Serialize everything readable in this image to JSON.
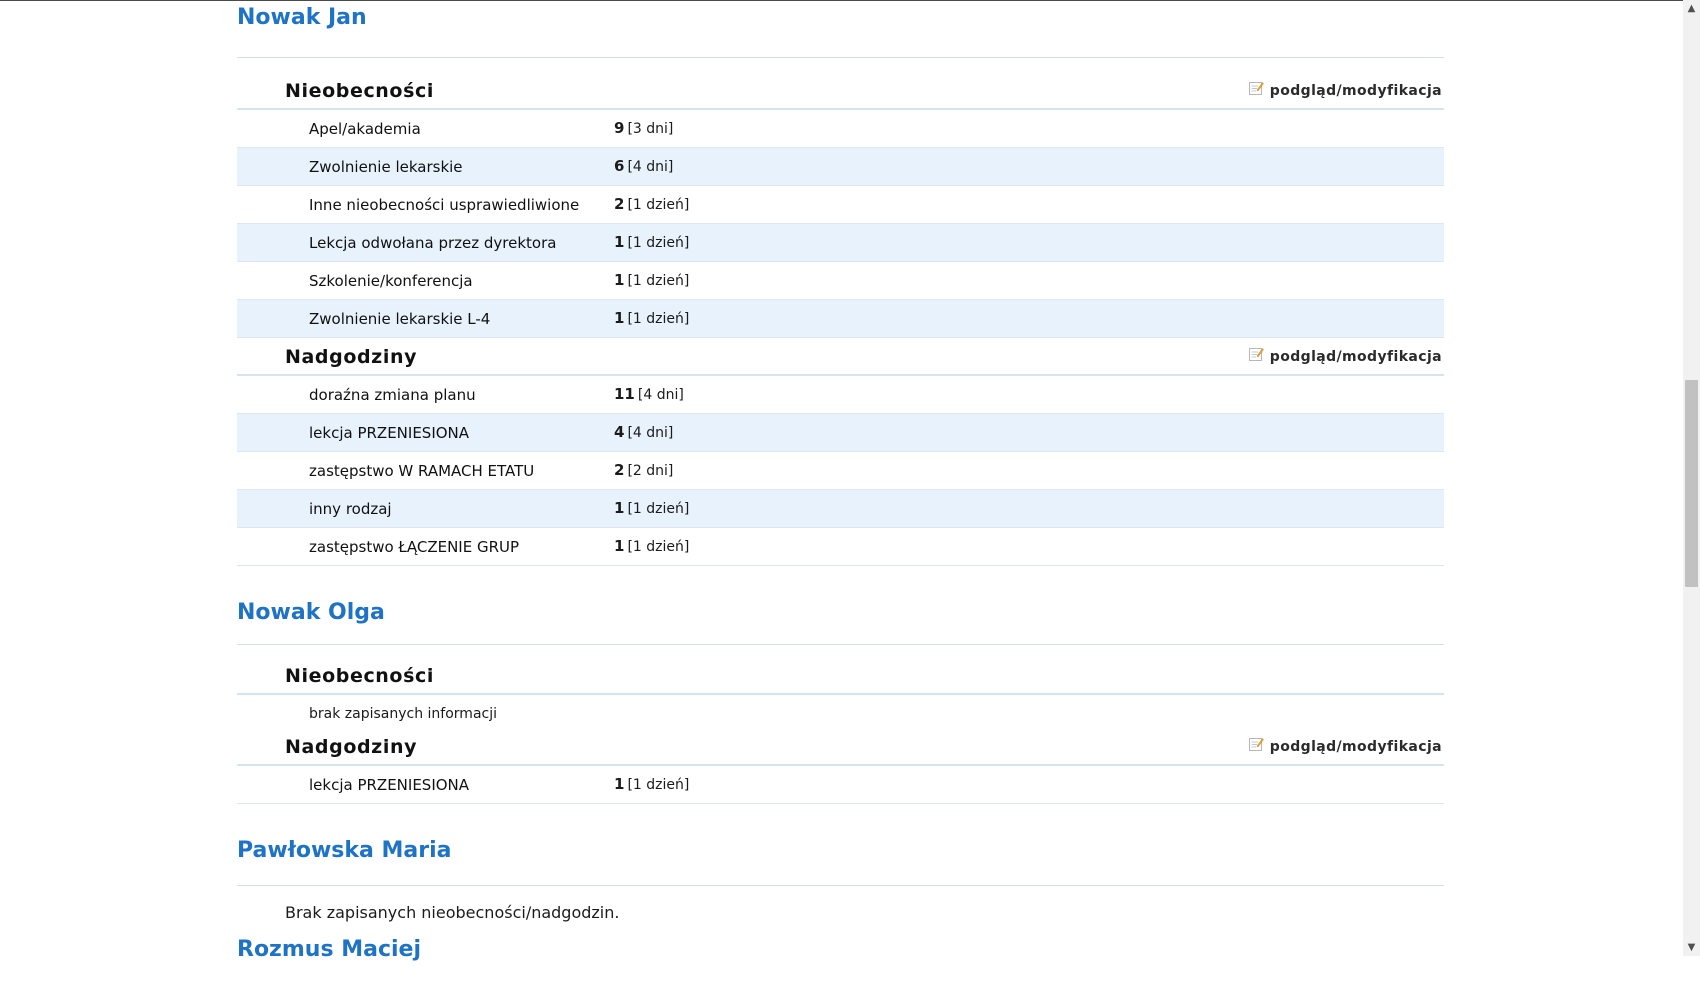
{
  "people": [
    {
      "name": "Nowak Jan",
      "absences": {
        "title": "Nieobecności",
        "link": "podgląd/modyfikacja",
        "rows": [
          {
            "label": "Apel/akademia",
            "count": "9",
            "days": "[3 dni]"
          },
          {
            "label": "Zwolnienie lekarskie",
            "count": "6",
            "days": "[4 dni]"
          },
          {
            "label": "Inne nieobecności usprawiedliwione",
            "count": "2",
            "days": "[1 dzień]"
          },
          {
            "label": "Lekcja odwołana przez dyrektora",
            "count": "1",
            "days": "[1 dzień]"
          },
          {
            "label": "Szkolenie/konferencja",
            "count": "1",
            "days": "[1 dzień]"
          },
          {
            "label": "Zwolnienie lekarskie L-4",
            "count": "1",
            "days": "[1 dzień]"
          }
        ]
      },
      "overtime": {
        "title": "Nadgodziny",
        "link": "podgląd/modyfikacja",
        "rows": [
          {
            "label": "doraźna zmiana planu",
            "count": "11",
            "days": "[4 dni]"
          },
          {
            "label": "lekcja PRZENIESIONA",
            "count": "4",
            "days": "[4 dni]"
          },
          {
            "label": "zastępstwo W RAMACH ETATU",
            "count": "2",
            "days": "[2 dni]"
          },
          {
            "label": "inny rodzaj",
            "count": "1",
            "days": "[1 dzień]"
          },
          {
            "label": "zastępstwo ŁĄCZENIE GRUP",
            "count": "1",
            "days": "[1 dzień]"
          }
        ]
      }
    },
    {
      "name": "Nowak Olga",
      "absences": {
        "title": "Nieobecności",
        "empty": "brak zapisanych informacji"
      },
      "overtime": {
        "title": "Nadgodziny",
        "link": "podgląd/modyfikacja",
        "rows": [
          {
            "label": "lekcja PRZENIESIONA",
            "count": "1",
            "days": "[1 dzień]"
          }
        ]
      }
    },
    {
      "name": "Pawłowska Maria",
      "none": "Brak zapisanych nieobecności/nadgodzin."
    },
    {
      "name": "Rozmus Maciej"
    }
  ],
  "colors": {
    "link_blue": "#1f73c6",
    "row_alt": "#e8f2fc",
    "divider": "#d4e4f1"
  },
  "icons": {
    "edit": "edit-icon"
  }
}
